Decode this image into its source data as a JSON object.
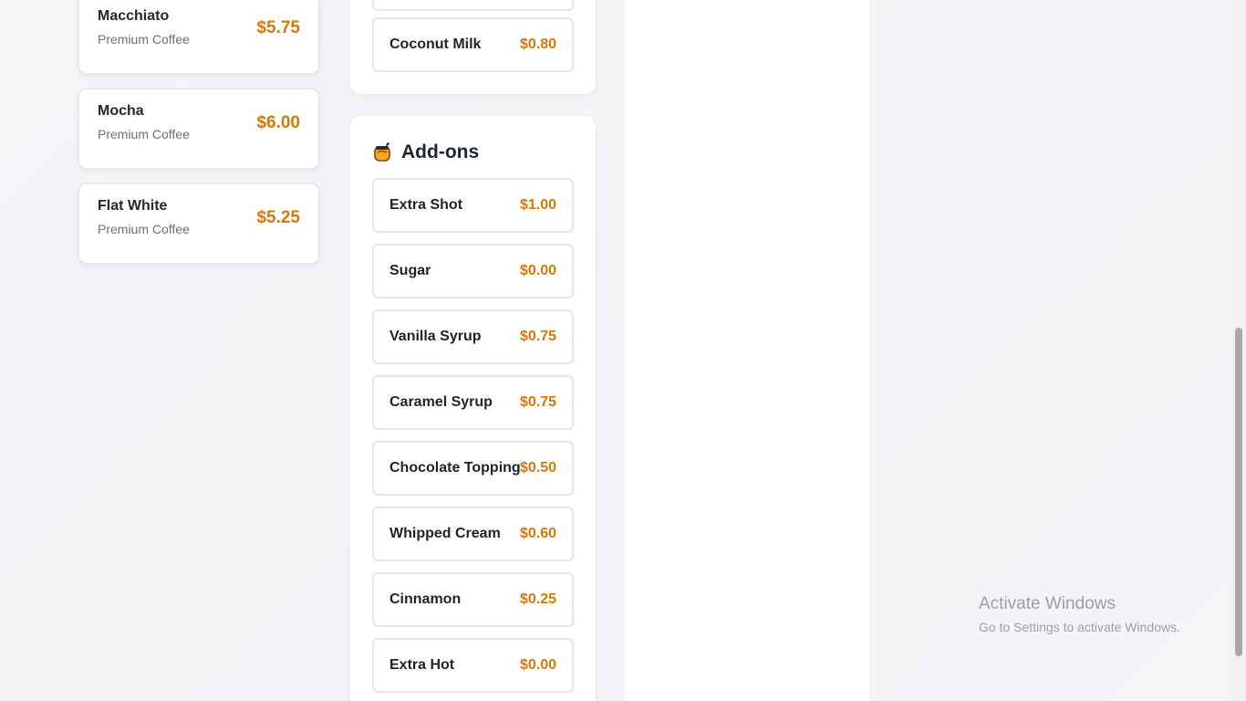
{
  "coffees": [
    {
      "name": "Macchiato",
      "category": "Premium Coffee",
      "price": "$5.75"
    },
    {
      "name": "Mocha",
      "category": "Premium Coffee",
      "price": "$6.00"
    },
    {
      "name": "Flat White",
      "category": "Premium Coffee",
      "price": "$5.25"
    }
  ],
  "milk_panel": {
    "items": [
      {
        "label": "Coconut Milk",
        "price": "$0.80"
      }
    ]
  },
  "addons_panel": {
    "title": "Add-ons",
    "icon": "honey-pot-icon",
    "items": [
      {
        "label": "Extra Shot",
        "price": "$1.00"
      },
      {
        "label": "Sugar",
        "price": "$0.00"
      },
      {
        "label": "Vanilla Syrup",
        "price": "$0.75"
      },
      {
        "label": "Caramel Syrup",
        "price": "$0.75"
      },
      {
        "label": "Chocolate Topping",
        "price": "$0.50"
      },
      {
        "label": "Whipped Cream",
        "price": "$0.60"
      },
      {
        "label": "Cinnamon",
        "price": "$0.25"
      },
      {
        "label": "Extra Hot",
        "price": "$0.00"
      }
    ]
  },
  "watermark": {
    "title": "Activate Windows",
    "subtitle": "Go to Settings to activate Windows."
  },
  "colors": {
    "accent_price": "#d97706",
    "background": "#f3f5f7"
  }
}
